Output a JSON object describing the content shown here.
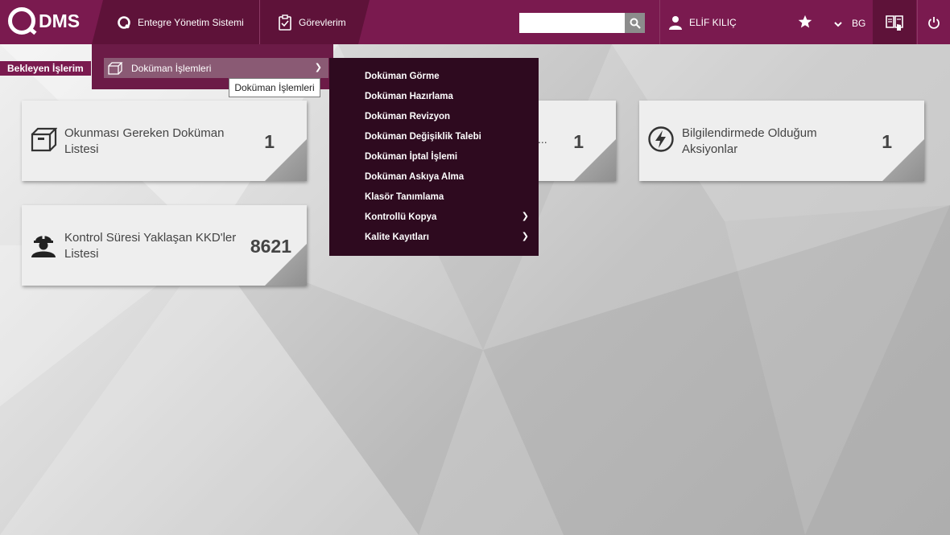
{
  "header": {
    "logo_text": "DMS",
    "nav": [
      {
        "label": "Entegre Yönetim Sistemi",
        "icon": "q-logo-icon"
      },
      {
        "label": "Görevlerim",
        "icon": "clipboard-check-icon"
      }
    ],
    "search": {
      "value": "",
      "placeholder": ""
    },
    "user_name": "ELİF KILIÇ",
    "lang": "BG"
  },
  "page": {
    "label": "Bekleyen İşlerim"
  },
  "menu": {
    "level1": {
      "label": "Doküman İşlemleri",
      "icon": "box-icon"
    },
    "tooltip": "Doküman İşlemleri",
    "level2": [
      {
        "label": "Doküman Görme",
        "has_sub": false
      },
      {
        "label": "Doküman Hazırlama",
        "has_sub": false
      },
      {
        "label": "Doküman Revizyon",
        "has_sub": false
      },
      {
        "label": "Doküman Değişiklik Talebi",
        "has_sub": false
      },
      {
        "label": "Doküman İptal İşlemi",
        "has_sub": false
      },
      {
        "label": "Doküman Askıya Alma",
        "has_sub": false
      },
      {
        "label": "Klasör Tanımlama",
        "has_sub": false
      },
      {
        "label": "Kontrollü Kopya",
        "has_sub": true
      },
      {
        "label": "Kalite Kayıtları",
        "has_sub": true
      }
    ]
  },
  "cards": [
    {
      "title": "Okunması Gereken Doküman Listesi",
      "count": "1",
      "icon": "box-icon"
    },
    {
      "title": "",
      "partial_text": "...",
      "count": "1",
      "icon": ""
    },
    {
      "title": "Bilgilendirmede Olduğum Aksiyonlar",
      "count": "1",
      "icon": "lightning-icon"
    },
    {
      "title": "Kontrol Süresi Yaklaşan KKD'ler Listesi",
      "count": "8621",
      "icon": "worker-helmet-icon"
    }
  ],
  "colors": {
    "brand": "#7a1a4f",
    "brand_dark": "#5e1239",
    "submenu_bg": "#2e0a1f",
    "card_bg": "#eeeeee"
  }
}
